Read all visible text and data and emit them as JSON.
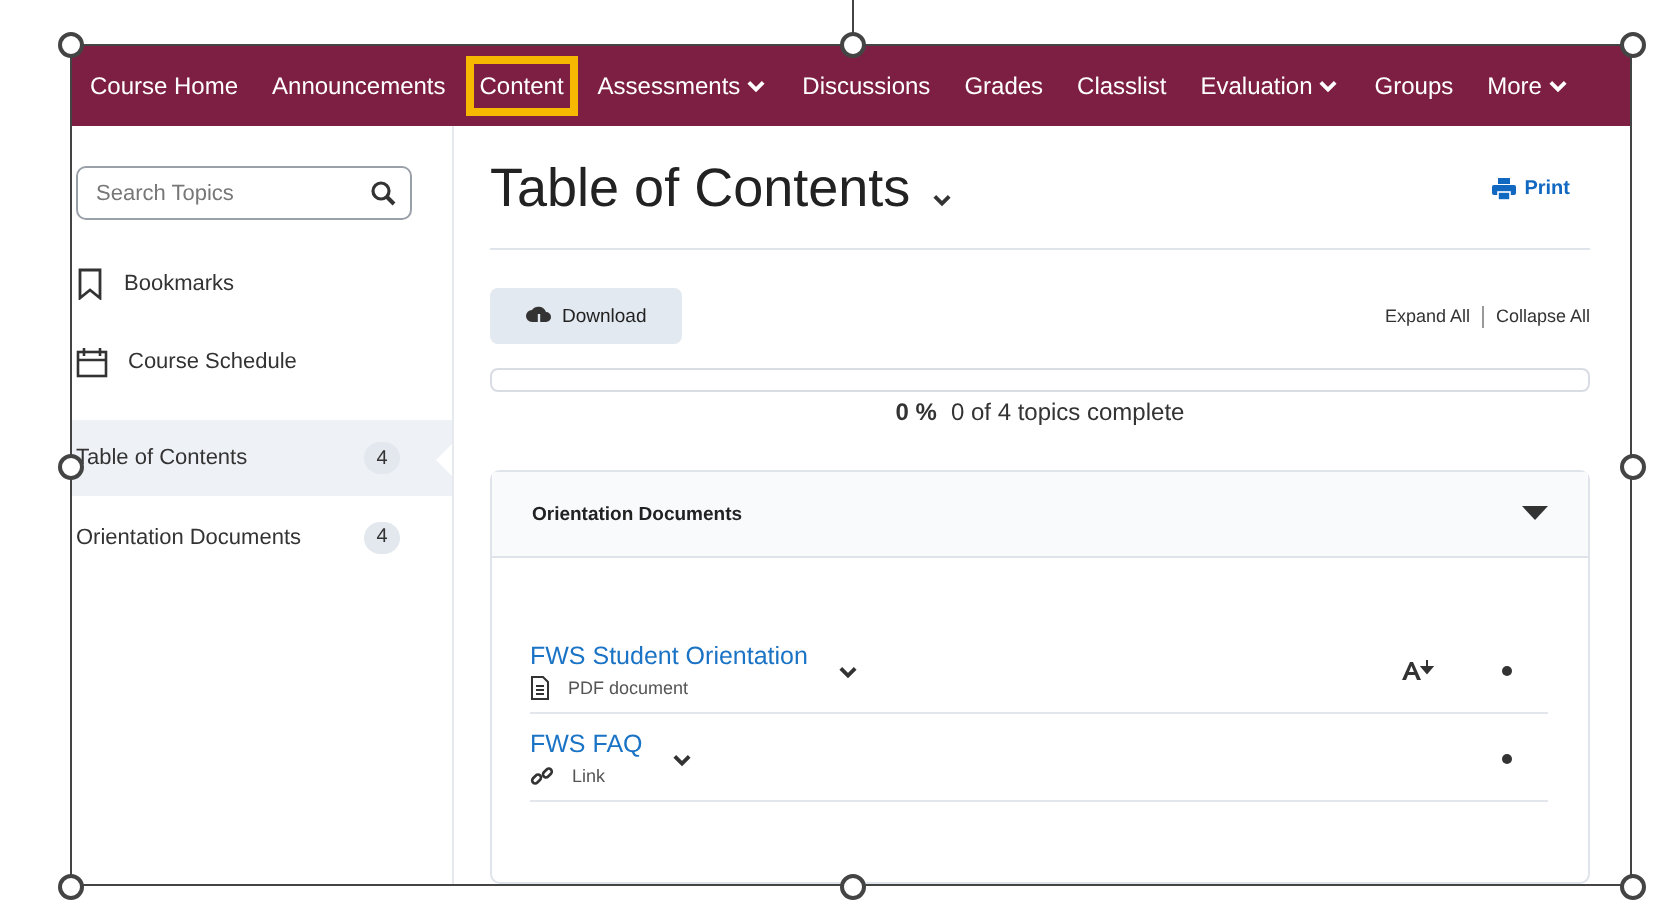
{
  "nav": {
    "items": [
      {
        "label": "Course Home",
        "selected": false,
        "dropdown": false
      },
      {
        "label": "Announcements",
        "selected": false,
        "dropdown": false
      },
      {
        "label": "Content",
        "selected": true,
        "dropdown": false
      },
      {
        "label": "Assessments",
        "selected": false,
        "dropdown": true
      },
      {
        "label": "Discussions",
        "selected": false,
        "dropdown": false
      },
      {
        "label": "Grades",
        "selected": false,
        "dropdown": false
      },
      {
        "label": "Classlist",
        "selected": false,
        "dropdown": false
      },
      {
        "label": "Evaluation",
        "selected": false,
        "dropdown": true
      },
      {
        "label": "Groups",
        "selected": false,
        "dropdown": false
      },
      {
        "label": "More",
        "selected": false,
        "dropdown": true
      }
    ]
  },
  "sidebar": {
    "search": {
      "placeholder": "Search Topics"
    },
    "links": [
      {
        "label": "Bookmarks",
        "kind": "bookmark"
      },
      {
        "label": "Course Schedule",
        "kind": "calendar"
      }
    ],
    "modules": [
      {
        "label": "Table of Contents",
        "count": "4",
        "selected": true
      },
      {
        "label": "Orientation Documents",
        "count": "4",
        "selected": false
      }
    ]
  },
  "main": {
    "title": "Table of Contents",
    "print": "Print",
    "download": "Download",
    "expand_all": "Expand All",
    "collapse_all": "Collapse All",
    "progress": {
      "level": 0,
      "percent": "0 %",
      "summary": "0 of 4 topics complete"
    },
    "module": {
      "title": "Orientation Documents",
      "expanded": true,
      "topics": [
        {
          "title": "FWS Student Orientation",
          "type": "PDF document",
          "kind": "pdf",
          "downloadable": true
        },
        {
          "title": "FWS FAQ",
          "type": "Link",
          "kind": "link",
          "downloadable": false
        }
      ]
    }
  }
}
